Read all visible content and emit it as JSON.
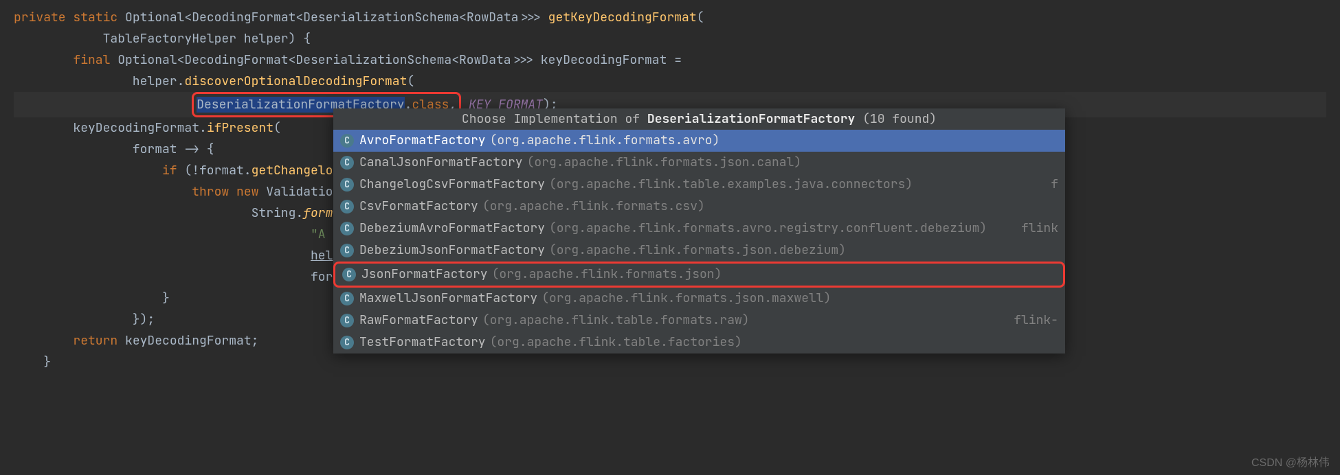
{
  "code": {
    "l1_private": "private",
    "l1_static": "static",
    "l1_type": " Optional<DecodingFormat<DeserializationSchema<RowData>>> ",
    "l1_method": "getKeyDecodingFormat",
    "l1_paren": "(",
    "l2": "            TableFactoryHelper helper) {",
    "l3_final": "final",
    "l3_rest": " Optional<DecodingFormat<DeserializationSchema<RowData>>> keyDecodingFormat =",
    "l4_a": "                helper.",
    "l4_b": "discoverOptionalDecodingFormat",
    "l4_c": "(",
    "l5_pad": "                        ",
    "l5_sel": "DeserializationFormatFactory",
    "l5_dot": ".",
    "l5_class": "class",
    "l5_comma": ",",
    "l5_key": " KEY_FORMAT",
    "l5_end": ");",
    "l6_a": "        keyDecodingFormat.",
    "l6_b": "ifPresent",
    "l6_c": "(",
    "l7": "                format -> {",
    "l8_a": "                    ",
    "l8_if": "if",
    "l8_b": " (!format.",
    "l8_c": "getChangelogMo",
    "l9_a": "                        ",
    "l9_throw": "throw",
    "l9_sp": " ",
    "l9_new": "new",
    "l9_b": " ValidationEx",
    "l10_a": "                                String.",
    "l10_b": "format",
    "l10_c": "(",
    "l11_a": "                                        ",
    "l11_str": "\"A key",
    "l12": "",
    "l13_a": "                                        ",
    "l13_helper": "helper",
    "l14_a": "                                        format",
    "l15": "                    }",
    "l16": "                });",
    "l17_a": "        ",
    "l17_return": "return",
    "l17_b": " keyDecodingFormat;",
    "l18": "    }"
  },
  "popup": {
    "header_a": "Choose Implementation of ",
    "header_b": "DeserializationFormatFactory",
    "header_c": " (10 found)",
    "items": [
      {
        "name": "AvroFormatFactory",
        "pkg": "(org.apache.flink.formats.avro)",
        "hint": ""
      },
      {
        "name": "CanalJsonFormatFactory",
        "pkg": "(org.apache.flink.formats.json.canal)",
        "hint": ""
      },
      {
        "name": "ChangelogCsvFormatFactory",
        "pkg": "(org.apache.flink.table.examples.java.connectors)",
        "hint": "f"
      },
      {
        "name": "CsvFormatFactory",
        "pkg": "(org.apache.flink.formats.csv)",
        "hint": ""
      },
      {
        "name": "DebeziumAvroFormatFactory",
        "pkg": "(org.apache.flink.formats.avro.registry.confluent.debezium)",
        "hint": "flink"
      },
      {
        "name": "DebeziumJsonFormatFactory",
        "pkg": "(org.apache.flink.formats.json.debezium)",
        "hint": ""
      },
      {
        "name": "JsonFormatFactory",
        "pkg": "(org.apache.flink.formats.json)",
        "hint": ""
      },
      {
        "name": "MaxwellJsonFormatFactory",
        "pkg": "(org.apache.flink.formats.json.maxwell)",
        "hint": ""
      },
      {
        "name": "RawFormatFactory",
        "pkg": "(org.apache.flink.table.formats.raw)",
        "hint": "flink-"
      },
      {
        "name": "TestFormatFactory",
        "pkg": "(org.apache.flink.table.factories)",
        "hint": ""
      }
    ],
    "icon_letter": "C"
  },
  "watermark": "CSDN @杨林伟"
}
